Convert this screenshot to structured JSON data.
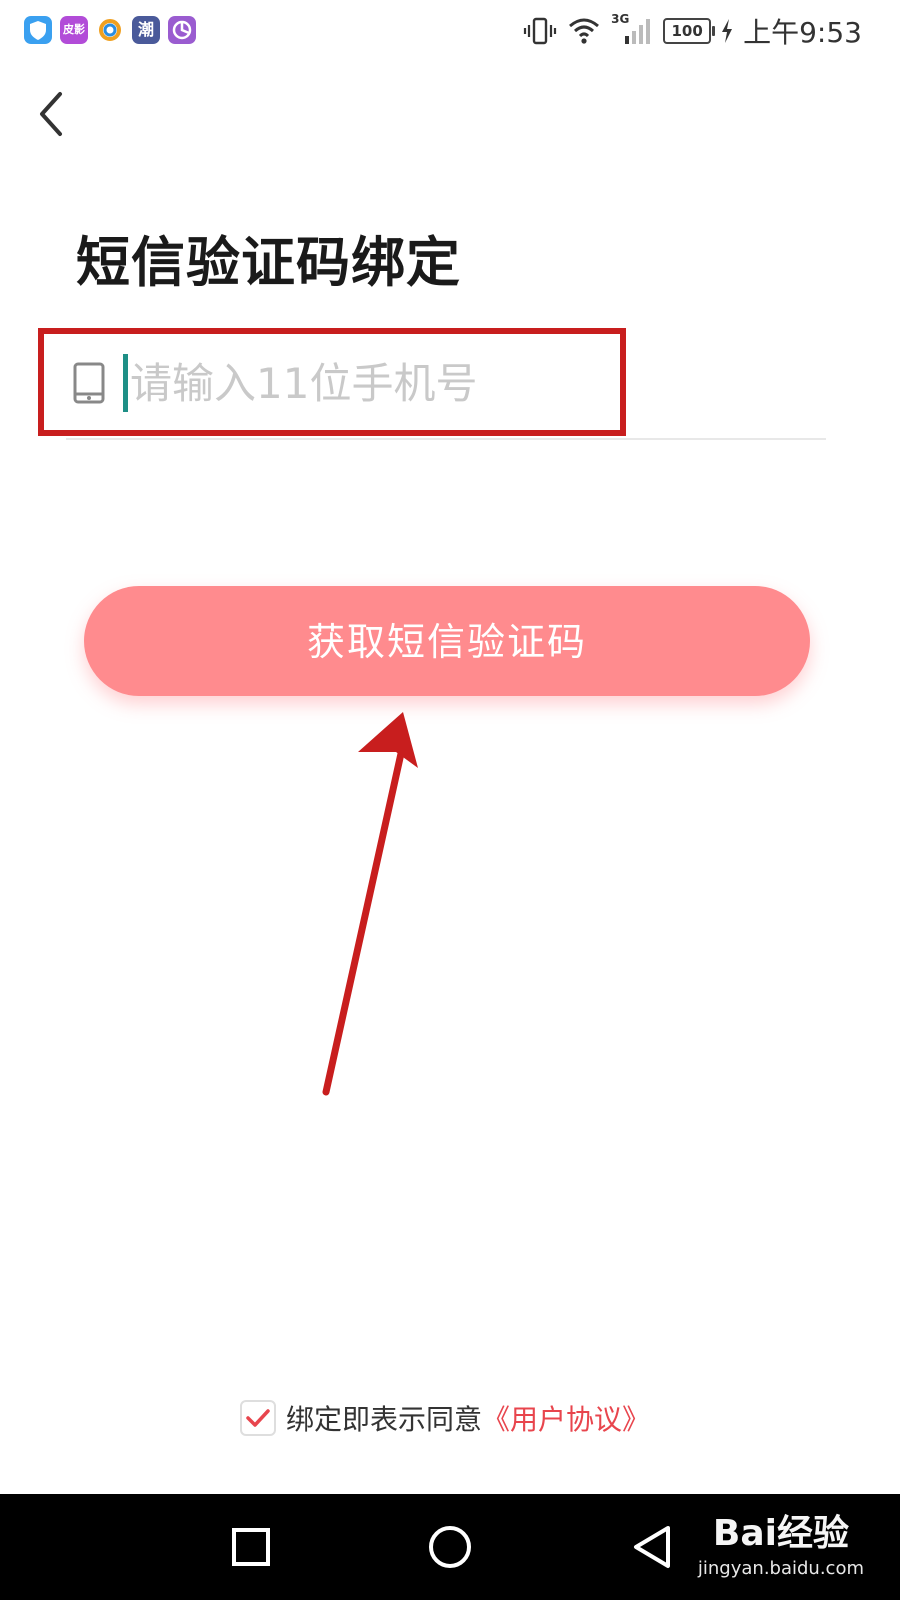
{
  "status_bar": {
    "apps": [
      {
        "icon": "shield-app-icon",
        "label": "",
        "color": "#3aa0f0"
      },
      {
        "icon": "app-icon-pixiu",
        "label": "皮影",
        "color": "#b24cd8"
      },
      {
        "icon": "browser-app-icon",
        "label": "",
        "color": "#ffffff"
      },
      {
        "icon": "app-icon-chao",
        "label": "潮",
        "color": "#4a5a9a"
      },
      {
        "icon": "pie-app-icon",
        "label": "",
        "color": "#9a5cd0"
      }
    ],
    "network": "3G",
    "battery": "100",
    "time": "上午9:53"
  },
  "header": {
    "back_icon": "chevron-left-icon"
  },
  "main": {
    "title": "短信验证码绑定",
    "phone_placeholder": "请输入11位手机号",
    "phone_value": "",
    "get_code_label": "获取短信验证码"
  },
  "agreement": {
    "checked": true,
    "text": "绑定即表示同意",
    "link": "《用户协议》"
  },
  "nav_bar": {
    "icons": [
      "recent-apps-icon",
      "home-icon",
      "back-icon"
    ]
  },
  "watermark": {
    "logo_text": "Bai经验",
    "url": "jingyan.baidu.com"
  },
  "colors": {
    "accent": "#ff8b8e",
    "link": "#e8454d",
    "annotation": "#c81e1e",
    "caret": "#1e8f86"
  }
}
